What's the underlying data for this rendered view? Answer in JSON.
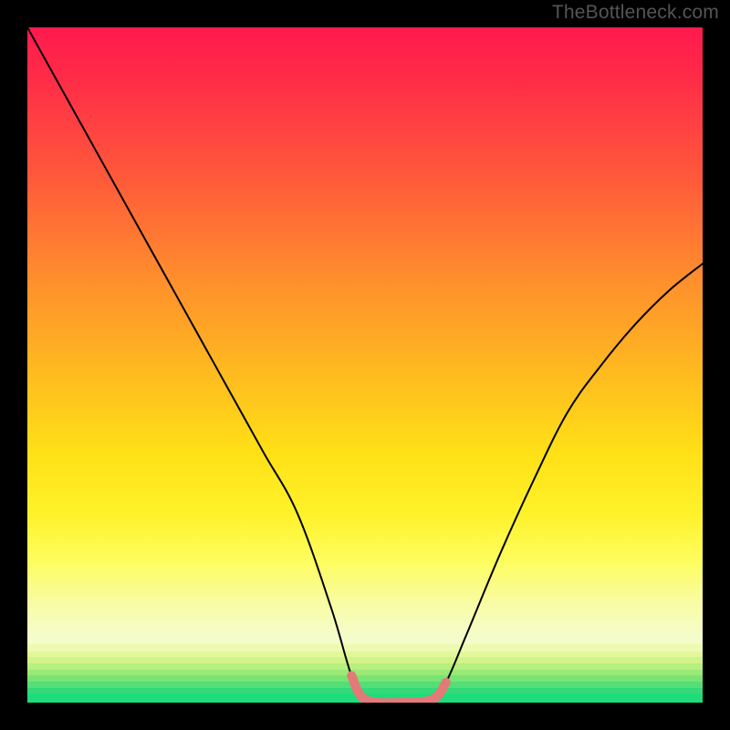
{
  "watermark": "TheBottleneck.com",
  "colors": {
    "frame_background": "#000000",
    "curve": "#000000",
    "highlight": "#e37a78",
    "gradient_top": "#ff1a4d",
    "gradient_mid": "#ffe016",
    "gradient_green": "#1edc7a"
  },
  "chart_data": {
    "type": "line",
    "title": "",
    "xlabel": "",
    "ylabel": "",
    "xlim": [
      0,
      100
    ],
    "ylim": [
      0,
      100
    ],
    "series": [
      {
        "name": "bottleneck-curve",
        "x": [
          0,
          5,
          10,
          15,
          20,
          25,
          30,
          35,
          40,
          45,
          48,
          50,
          55,
          60,
          62,
          65,
          70,
          75,
          80,
          85,
          90,
          95,
          100
        ],
        "y": [
          100,
          91,
          82,
          73,
          64,
          55,
          46,
          37,
          28,
          14,
          4,
          0.5,
          0,
          0.5,
          3,
          10,
          22,
          33,
          43,
          50,
          56,
          61,
          65
        ]
      },
      {
        "name": "optimal-range-highlight",
        "x": [
          48,
          50,
          55,
          60,
          62
        ],
        "y": [
          4,
          0.5,
          0,
          0.5,
          3
        ]
      }
    ],
    "gradient_stripes": [
      {
        "height_pct": 14,
        "color": "#f4fcca"
      },
      {
        "height_pct": 10,
        "color": "#eefab0"
      },
      {
        "height_pct": 9,
        "color": "#e2f79a"
      },
      {
        "height_pct": 9,
        "color": "#d0f48a"
      },
      {
        "height_pct": 9,
        "color": "#b8ef7e"
      },
      {
        "height_pct": 9,
        "color": "#99ea76"
      },
      {
        "height_pct": 9,
        "color": "#78e474"
      },
      {
        "height_pct": 9,
        "color": "#54de76"
      },
      {
        "height_pct": 9,
        "color": "#34d97a"
      },
      {
        "height_pct": 13,
        "color": "#1edc7a"
      }
    ]
  }
}
